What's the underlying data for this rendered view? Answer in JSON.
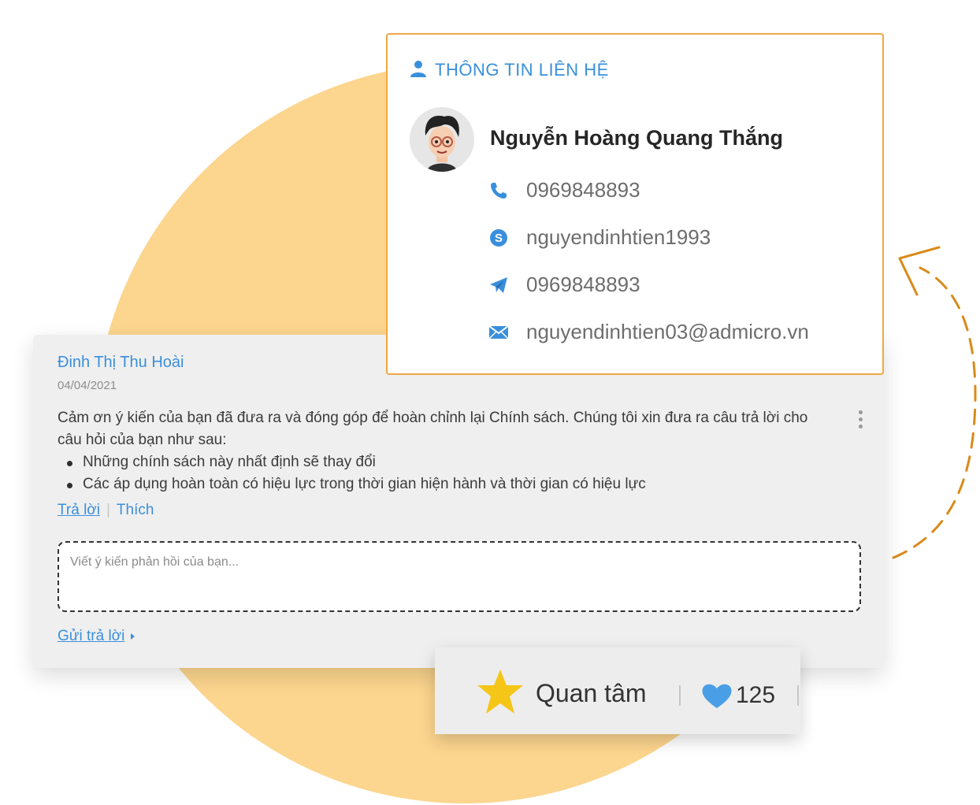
{
  "colors": {
    "accent_blue": "#3a8fdc",
    "circle_yellow": "#fcd58e",
    "card_border_orange": "#f0a742",
    "arrow_orange": "#d98a1a",
    "star_gold": "#f5c518"
  },
  "contact": {
    "title": "THÔNG TIN LIÊN HỆ",
    "title_icon": "user-icon",
    "name": "Nguyễn Hoàng Quang Thắng",
    "rows": [
      {
        "icon": "phone-icon",
        "value": "0969848893"
      },
      {
        "icon": "skype-icon",
        "value": "nguyendinhtien1993"
      },
      {
        "icon": "telegram-icon",
        "value": "0969848893"
      },
      {
        "icon": "mail-icon",
        "value": "nguyendinhtien03@admicro.vn"
      }
    ]
  },
  "comment": {
    "author": "Đinh Thị Thu Hoài",
    "date": "04/04/2021",
    "text": "Cảm ơn ý kiến của bạn đã đưa ra và đóng góp để hoàn chỉnh lại Chính sách. Chúng tôi xin đưa ra câu trả lời cho câu hỏi của bạn như sau:",
    "bullets": [
      "Những chính sách này nhất định sẽ thay đổi",
      "Các áp dụng hoàn toàn có hiệu lực trong thời gian hiện hành và thời gian có hiệu lực"
    ],
    "reply_label": "Trả lời",
    "like_label": "Thích",
    "reply_placeholder": "Viết ý kiến phản hồi của bạn...",
    "send_label": "Gửi trả lời"
  },
  "interest": {
    "label": "Quan tâm",
    "count": "125"
  }
}
